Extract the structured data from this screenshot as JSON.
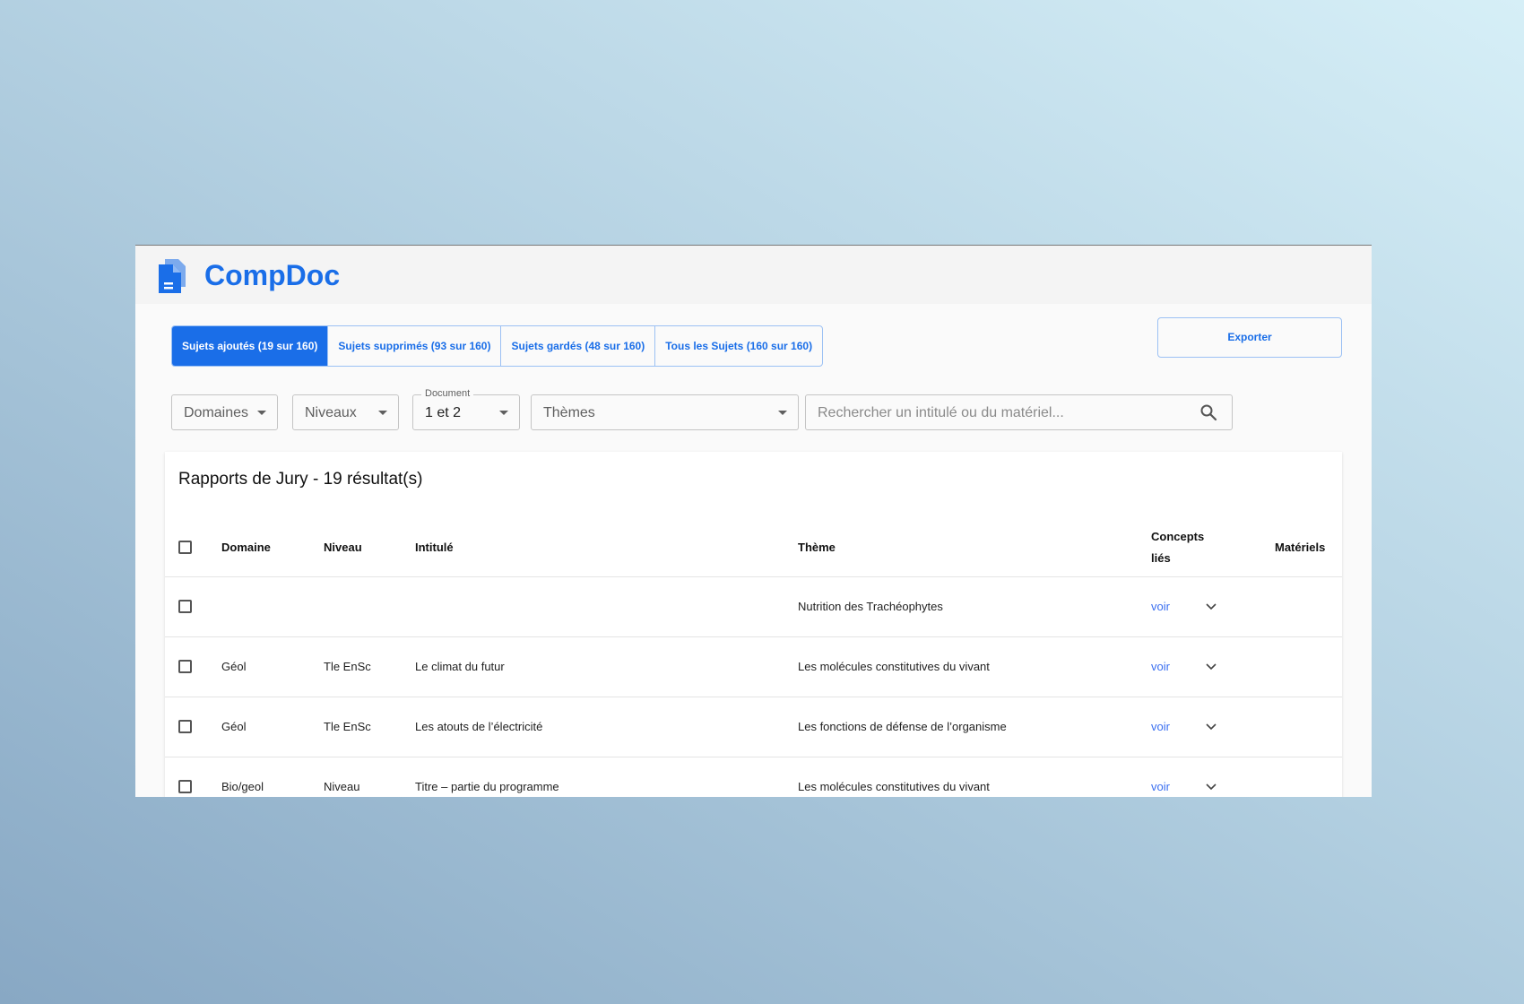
{
  "app": {
    "title": "CompDoc"
  },
  "tabs": [
    {
      "label": "Sujets ajoutés (19 sur 160)",
      "active": true
    },
    {
      "label": "Sujets supprimés (93 sur 160)",
      "active": false
    },
    {
      "label": "Sujets gardés (48 sur 160)",
      "active": false
    },
    {
      "label": "Tous les Sujets (160 sur 160)",
      "active": false
    }
  ],
  "export_label": "Exporter",
  "filters": {
    "domaines": "Domaines",
    "niveaux": "Niveaux",
    "document_label": "Document",
    "document_value": "1 et 2",
    "themes": "Thèmes",
    "search_placeholder": "Rechercher un intitulé ou du matériel..."
  },
  "table": {
    "title": "Rapports de Jury - 19 résultat(s)",
    "columns": {
      "domaine": "Domaine",
      "niveau": "Niveau",
      "intitule": "Intitulé",
      "theme": "Thème",
      "concepts_line1": "Concepts",
      "concepts_line2": "liés",
      "materiels": "Matériels"
    },
    "rows": [
      {
        "domaine": "",
        "niveau": "",
        "intitule": "",
        "theme": "Nutrition des Trachéophytes",
        "concepts": "voir"
      },
      {
        "domaine": "Géol",
        "niveau": "Tle EnSc",
        "intitule": "Le climat du futur",
        "theme": "Les molécules constitutives du vivant",
        "concepts": "voir"
      },
      {
        "domaine": "Géol",
        "niveau": "Tle EnSc",
        "intitule": "Les atouts de l’électricité",
        "theme": "Les fonctions de défense de l’organisme",
        "concepts": "voir"
      },
      {
        "domaine": "Bio/geol",
        "niveau": "Niveau",
        "intitule": "Titre – partie du programme",
        "theme": "Les molécules constitutives du vivant",
        "concepts": "voir"
      }
    ]
  },
  "colors": {
    "accent": "#1a6ee8",
    "link": "#3a6ff0"
  },
  "icons": [
    "document-logo-icon",
    "caret-down-icon",
    "search-icon",
    "checkbox-icon",
    "chevron-down-icon"
  ]
}
